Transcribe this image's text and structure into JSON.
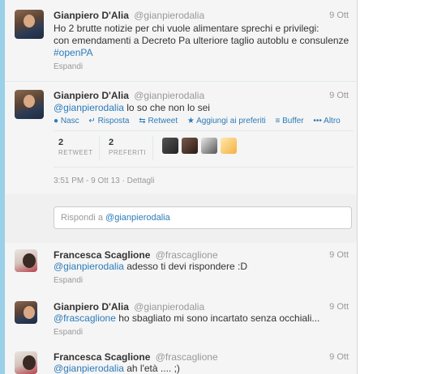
{
  "tweets": [
    {
      "fullname": "Gianpiero D'Alia",
      "username": "@gianpierodalia",
      "time": "9 Ott",
      "line1": "Ho 2 brutte notizie per chi vuole alimentare sprechi e privilegi:",
      "line2": "con emendamenti a Decreto Pa ulteriore taglio autoblu e consulenze",
      "hashtag": "#openPA",
      "expand": "Espandi"
    },
    {
      "fullname": "Gianpiero D'Alia",
      "username": "@gianpierodalia",
      "time": "9 Ott",
      "mention": "@gianpierodalia",
      "text": " lo so che non lo sei",
      "actions": {
        "hide": "Nasc",
        "reply": "Risposta",
        "retweet": "Retweet",
        "favorite": "Aggiungi ai preferiti",
        "buffer": "Buffer",
        "more": "Altro"
      },
      "stats": {
        "retweets": "2",
        "retweets_label": "RETWEET",
        "favorites": "2",
        "favorites_label": "PREFERITI"
      },
      "details": "3:51 PM - 9 Ott 13 · Dettagli"
    },
    {
      "fullname": "Francesca Scaglione",
      "username": "@frascaglione",
      "time": "9 Ott",
      "mention": "@gianpierodalia",
      "text": " adesso ti devi rispondere :D",
      "expand": "Espandi"
    },
    {
      "fullname": "Gianpiero D'Alia",
      "username": "@gianpierodalia",
      "time": "9 Ott",
      "mention": "@frascaglione",
      "text": " ho sbagliato mi sono incartato senza occhiali...",
      "expand": "Espandi"
    },
    {
      "fullname": "Francesca Scaglione",
      "username": "@frascaglione",
      "time": "9 Ott",
      "mention": "@gianpierodalia",
      "text": " ah l'età .... ;)"
    }
  ],
  "reply": {
    "prefix": "Rispondi a ",
    "mention": "@gianpierodalia"
  },
  "colors": {
    "link": "#2b7bb9",
    "muted": "#999999",
    "text": "#333333"
  }
}
